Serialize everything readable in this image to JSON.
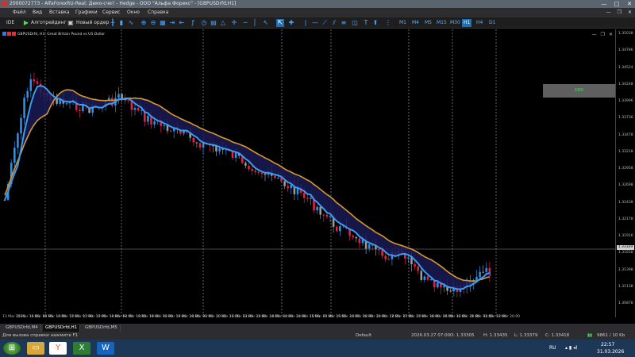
{
  "window": {
    "title": "2000072773 - AlfaForexRU-Real: Демо-счет - Hedge - ООО \"Альфа Форекс\" - [GBPUSDrfd,H1]",
    "controls": [
      "—",
      "□",
      "✕"
    ]
  },
  "menu": [
    "Файл",
    "Вид",
    "Вставка",
    "Графики",
    "Сервис",
    "Окно",
    "Справка"
  ],
  "toolbar": {
    "ide": "IDE",
    "algo_label": "Алготрейдинг",
    "new_order_label": "Новый ордер",
    "timeframes": [
      "M1",
      "M4",
      "M5",
      "M15",
      "M30",
      "H1",
      "H4",
      "D1"
    ],
    "active_timeframe": "H1"
  },
  "chart": {
    "info": "GBPUSDrfd, H1:  Great Britain Pound vs US Dollar",
    "dr_label": "DRD",
    "price_labels": [
      "1.35038",
      "1.34786",
      "1.34524",
      "1.34248",
      "1.33996",
      "1.33736",
      "1.33478",
      "1.33218",
      "1.32958",
      "1.32698",
      "1.32438",
      "1.32178",
      "1.31916",
      "1.31658",
      "1.31398",
      "1.31138",
      "1.30878"
    ],
    "current_price": "1.33329",
    "time_labels": [
      "13 Mar 2026",
      "13 Mar 16:00",
      "16 Mar 02:00",
      "16 Mar 10:00",
      "16 Mar 18:00",
      "17 Mar 02:00",
      "17 Mar 10:00",
      "17 Mar 18:00",
      "18 Mar 02:00",
      "18 Mar 10:00",
      "18 Mar 18:00",
      "19 Mar 02:00",
      "19 Mar 10:00",
      "19 Mar 18:00",
      "20 Mar 02:00",
      "20 Mar 10:00",
      "20 Mar 18:00",
      "23 Mar 02:00",
      "23 Mar 10:00",
      "23 Mar 18:00",
      "24 Mar 02:00",
      "24 Mar 10:00",
      "24 Mar 18:00",
      "25 Mar 02:00",
      "25 Mar 10:00",
      "25 Mar 18:00",
      "26 Mar 02:00",
      "26 Mar 10:00",
      "26 Mar 18:00",
      "27 Mar 02:00",
      "27 Mar 10:00",
      "27 Mar 18:00",
      "30 Mar 04:00",
      "30 Mar 12:00",
      "30 Mar 20:00",
      "31 Mar 04:00",
      "31 Mar 12:00",
      "31 Mar 20:00"
    ],
    "colors": {
      "bull": "#2f8fe8",
      "bear": "#e0234b",
      "neutral": "#9a9a9a",
      "fast_ma": "#3b9cf0",
      "slow_ma": "#d79b2a",
      "cloud_down": "#1a1a55",
      "cloud_up": "#3a1010"
    }
  },
  "tabs": [
    "GBPUSDrfd,M4",
    "GBPUSDrfd,H1",
    "GBPUSDrfd,M5"
  ],
  "active_tab": "GBPUSDrfd,H1",
  "status": {
    "help": "Для вызова справки нажмите F1",
    "profile": "Default",
    "datetime": "2026.03.27 07:00",
    "open": "O: 1.33305",
    "high": "H: 1.33435",
    "low": "L: 1.33379",
    "close": "C: 1.33418",
    "traffic": "9861 / 10 Kb"
  },
  "tray": {
    "lang": "RU",
    "time": "22:57",
    "date": "31.03.2026"
  }
}
